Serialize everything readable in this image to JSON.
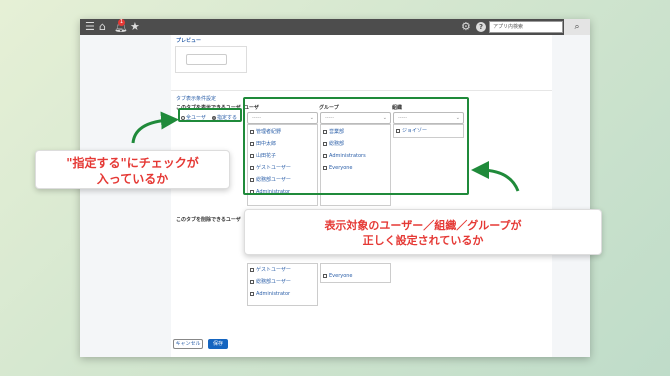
{
  "topbar": {
    "badge": "1",
    "search_placeholder": "アプリ内検索",
    "menu_icon": "menu-icon",
    "home_icon": "home-icon",
    "bell_icon": "bell-icon",
    "star_icon": "star-icon",
    "gear_icon": "gear-icon",
    "help_icon": "help-icon",
    "search_icon": "search-icon"
  },
  "preview": {
    "label": "プレビュー"
  },
  "tab_conditions": {
    "section_label": "タブ表示条件設定",
    "display_user_label": "このタブを表示できるユーザ",
    "radio_all": "全ユーザ",
    "radio_specify": "指定する",
    "column_user": "ユーザ",
    "column_group": "グループ",
    "column_org": "組織",
    "select_placeholder": "-----",
    "users": [
      "管理者紀野",
      "田中太郎",
      "山田花子",
      "ゲストユーザー",
      "総務部ユーザー",
      "Administrator"
    ],
    "groups": [
      "営業部",
      "総務部",
      "Administrators",
      "Everyone"
    ],
    "orgs": [
      "ジョイゾー"
    ],
    "delete_user_label": "このタブを削除できるユーザ",
    "delete_users_visible": [
      "ゲストユーザー",
      "総務部ユーザー",
      "Administrator"
    ],
    "delete_groups_visible": [
      "Everyone"
    ]
  },
  "buttons": {
    "cancel": "キャンセル",
    "save": "保存"
  },
  "callouts": {
    "left_line1": "\"指定する\"にチェックが",
    "left_line2": "入っているか",
    "right_line1": "表示対象のユーザー／組織／グループが",
    "right_line2": "正しく設定されているか"
  },
  "colors": {
    "highlight": "#1f8a3a",
    "callout_text": "#e53935",
    "save_button": "#1565c0"
  }
}
